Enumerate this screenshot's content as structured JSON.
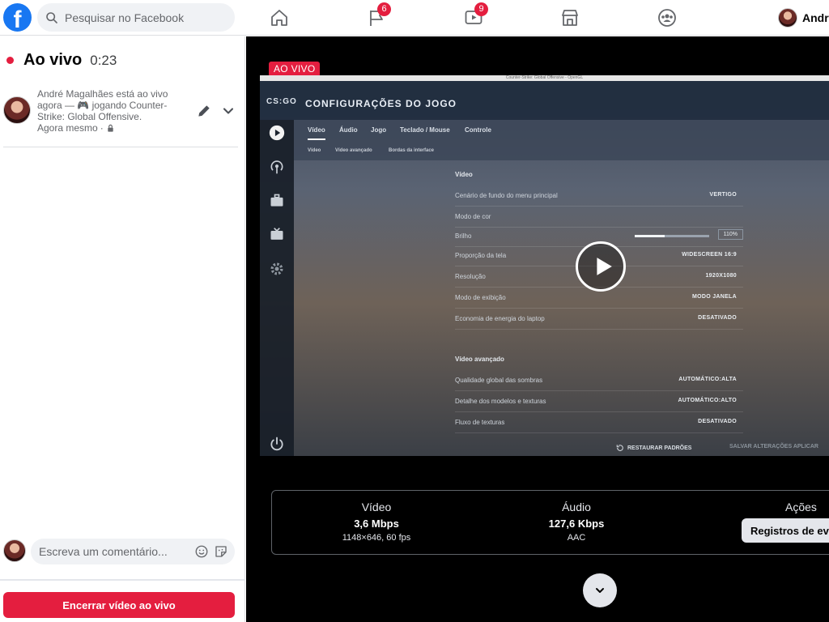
{
  "topbar": {
    "search_placeholder": "Pesquisar no Facebook",
    "groups_badge": "6",
    "watch_badge": "9",
    "profile_name": "André"
  },
  "left": {
    "live_title": "Ao vivo",
    "live_time": "0:23",
    "post_text": "André Magalhães está ao vivo agora — 🎮 jogando Counter-Strike: Global Offensive.",
    "post_time": "Agora mesmo",
    "comment_placeholder": "Escreva um comentário...",
    "end_button": "Encerrar vídeo ao vivo"
  },
  "video": {
    "live_badge": "AO VIVO",
    "window_title": "Counter-Strike: Global Offensive - OpenGL",
    "logo": "CS:GO",
    "game_title": "CONFIGURAÇÕES DO JOGO",
    "tabs": [
      "Vídeo",
      "Áudio",
      "Jogo",
      "Teclado / Mouse",
      "Controle"
    ],
    "subtabs": [
      "Vídeo",
      "Vídeo avançado",
      "Bordas da interface"
    ],
    "section_video": "Vídeo",
    "rows": [
      {
        "label": "Cenário de fundo do menu principal",
        "value": "VERTIGO"
      },
      {
        "label": "Modo de cor",
        "value": ""
      },
      {
        "label": "Brilho",
        "value": "110%",
        "level": 0.4
      },
      {
        "label": "Proporção da tela",
        "value": "WIDESCREEN 16:9"
      },
      {
        "label": "Resolução",
        "value": "1920X1080"
      },
      {
        "label": "Modo de exibição",
        "value": "MODO JANELA"
      },
      {
        "label": "Economia de energia do laptop",
        "value": "DESATIVADO"
      }
    ],
    "section_advanced": "Vídeo avançado",
    "adv_rows": [
      {
        "label": "Qualidade global das sombras",
        "value": "AUTOMÁTICO:ALTA"
      },
      {
        "label": "Detalhe dos modelos e texturas",
        "value": "AUTOMÁTICO:ALTO"
      },
      {
        "label": "Fluxo de texturas",
        "value": "DESATIVADO"
      }
    ],
    "restore_defaults": "RESTAURAR PADRÕES",
    "footer_dim": "SALVAR ALTERAÇÕES     APLICAR"
  },
  "stats": {
    "video_title": "Vídeo",
    "video_value": "3,6 Mbps",
    "video_sub": "1148×646, 60 fps",
    "audio_title": "Áudio",
    "audio_value": "127,6 Kbps",
    "audio_sub": "AAC",
    "actions_title": "Ações",
    "events_button": "Registros de eventos"
  }
}
